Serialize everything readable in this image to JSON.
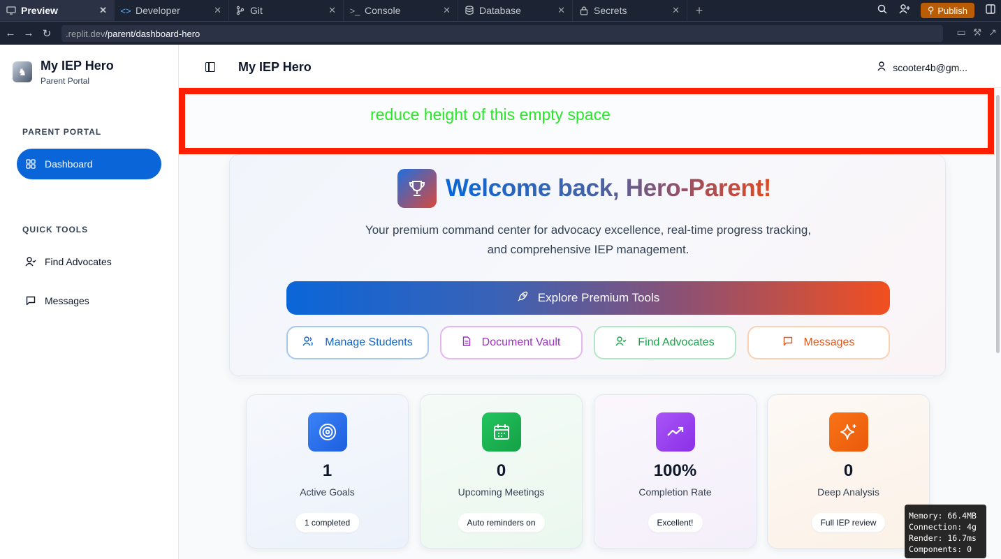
{
  "tabs": [
    {
      "label": "Preview",
      "icon": "monitor-icon",
      "active": true
    },
    {
      "label": "Developer",
      "icon": "code-icon",
      "active": false
    },
    {
      "label": "Git",
      "icon": "git-icon",
      "active": false
    },
    {
      "label": "Console",
      "icon": "terminal-icon",
      "active": false
    },
    {
      "label": "Database",
      "icon": "database-icon",
      "active": false
    },
    {
      "label": "Secrets",
      "icon": "lock-icon",
      "active": false
    }
  ],
  "toolbar": {
    "publish_label": "Publish"
  },
  "address": {
    "host": ".replit.dev",
    "path": "/parent/dashboard-hero"
  },
  "sidebar": {
    "brand_title": "My IEP Hero",
    "brand_subtitle": "Parent Portal",
    "section_portal": "PARENT PORTAL",
    "section_tools": "QUICK TOOLS",
    "items": [
      {
        "label": "Dashboard",
        "icon": "grid-icon",
        "active": true
      },
      {
        "label": "Find Advocates",
        "icon": "user-check-icon",
        "active": false
      },
      {
        "label": "Messages",
        "icon": "message-icon",
        "active": false
      }
    ]
  },
  "header": {
    "title": "My IEP Hero",
    "user_email": "scooter4b@gm..."
  },
  "annotation": {
    "text": "reduce height of this empty space",
    "border_color": "#ff1e00",
    "text_color": "#28e828"
  },
  "hero": {
    "title": "Welcome back, Hero-Parent!",
    "description": "Your premium command center for advocacy excellence, real-time progress tracking, and comprehensive IEP management.",
    "cta_label": "Explore Premium Tools",
    "quick_buttons": [
      {
        "label": "Manage Students",
        "icon": "users-icon"
      },
      {
        "label": "Document Vault",
        "icon": "file-icon"
      },
      {
        "label": "Find Advocates",
        "icon": "user-check-icon"
      },
      {
        "label": "Messages",
        "icon": "message-icon"
      }
    ]
  },
  "stats": [
    {
      "value": "1",
      "label": "Active Goals",
      "pill": "1 completed",
      "icon": "target-icon"
    },
    {
      "value": "0",
      "label": "Upcoming Meetings",
      "pill": "Auto reminders on",
      "icon": "calendar-icon"
    },
    {
      "value": "100%",
      "label": "Completion Rate",
      "pill": "Excellent!",
      "icon": "trending-up-icon"
    },
    {
      "value": "0",
      "label": "Deep Analysis",
      "pill": "Full IEP review",
      "icon": "sparkles-icon"
    }
  ],
  "perf": {
    "memory": "Memory: 66.4MB",
    "connection": "Connection: 4g",
    "render": "Render: 16.7ms",
    "components": "Components: 0"
  },
  "colors": {
    "primary": "#0a66d8",
    "accent": "#f24f1f",
    "publish": "#b85c06"
  }
}
